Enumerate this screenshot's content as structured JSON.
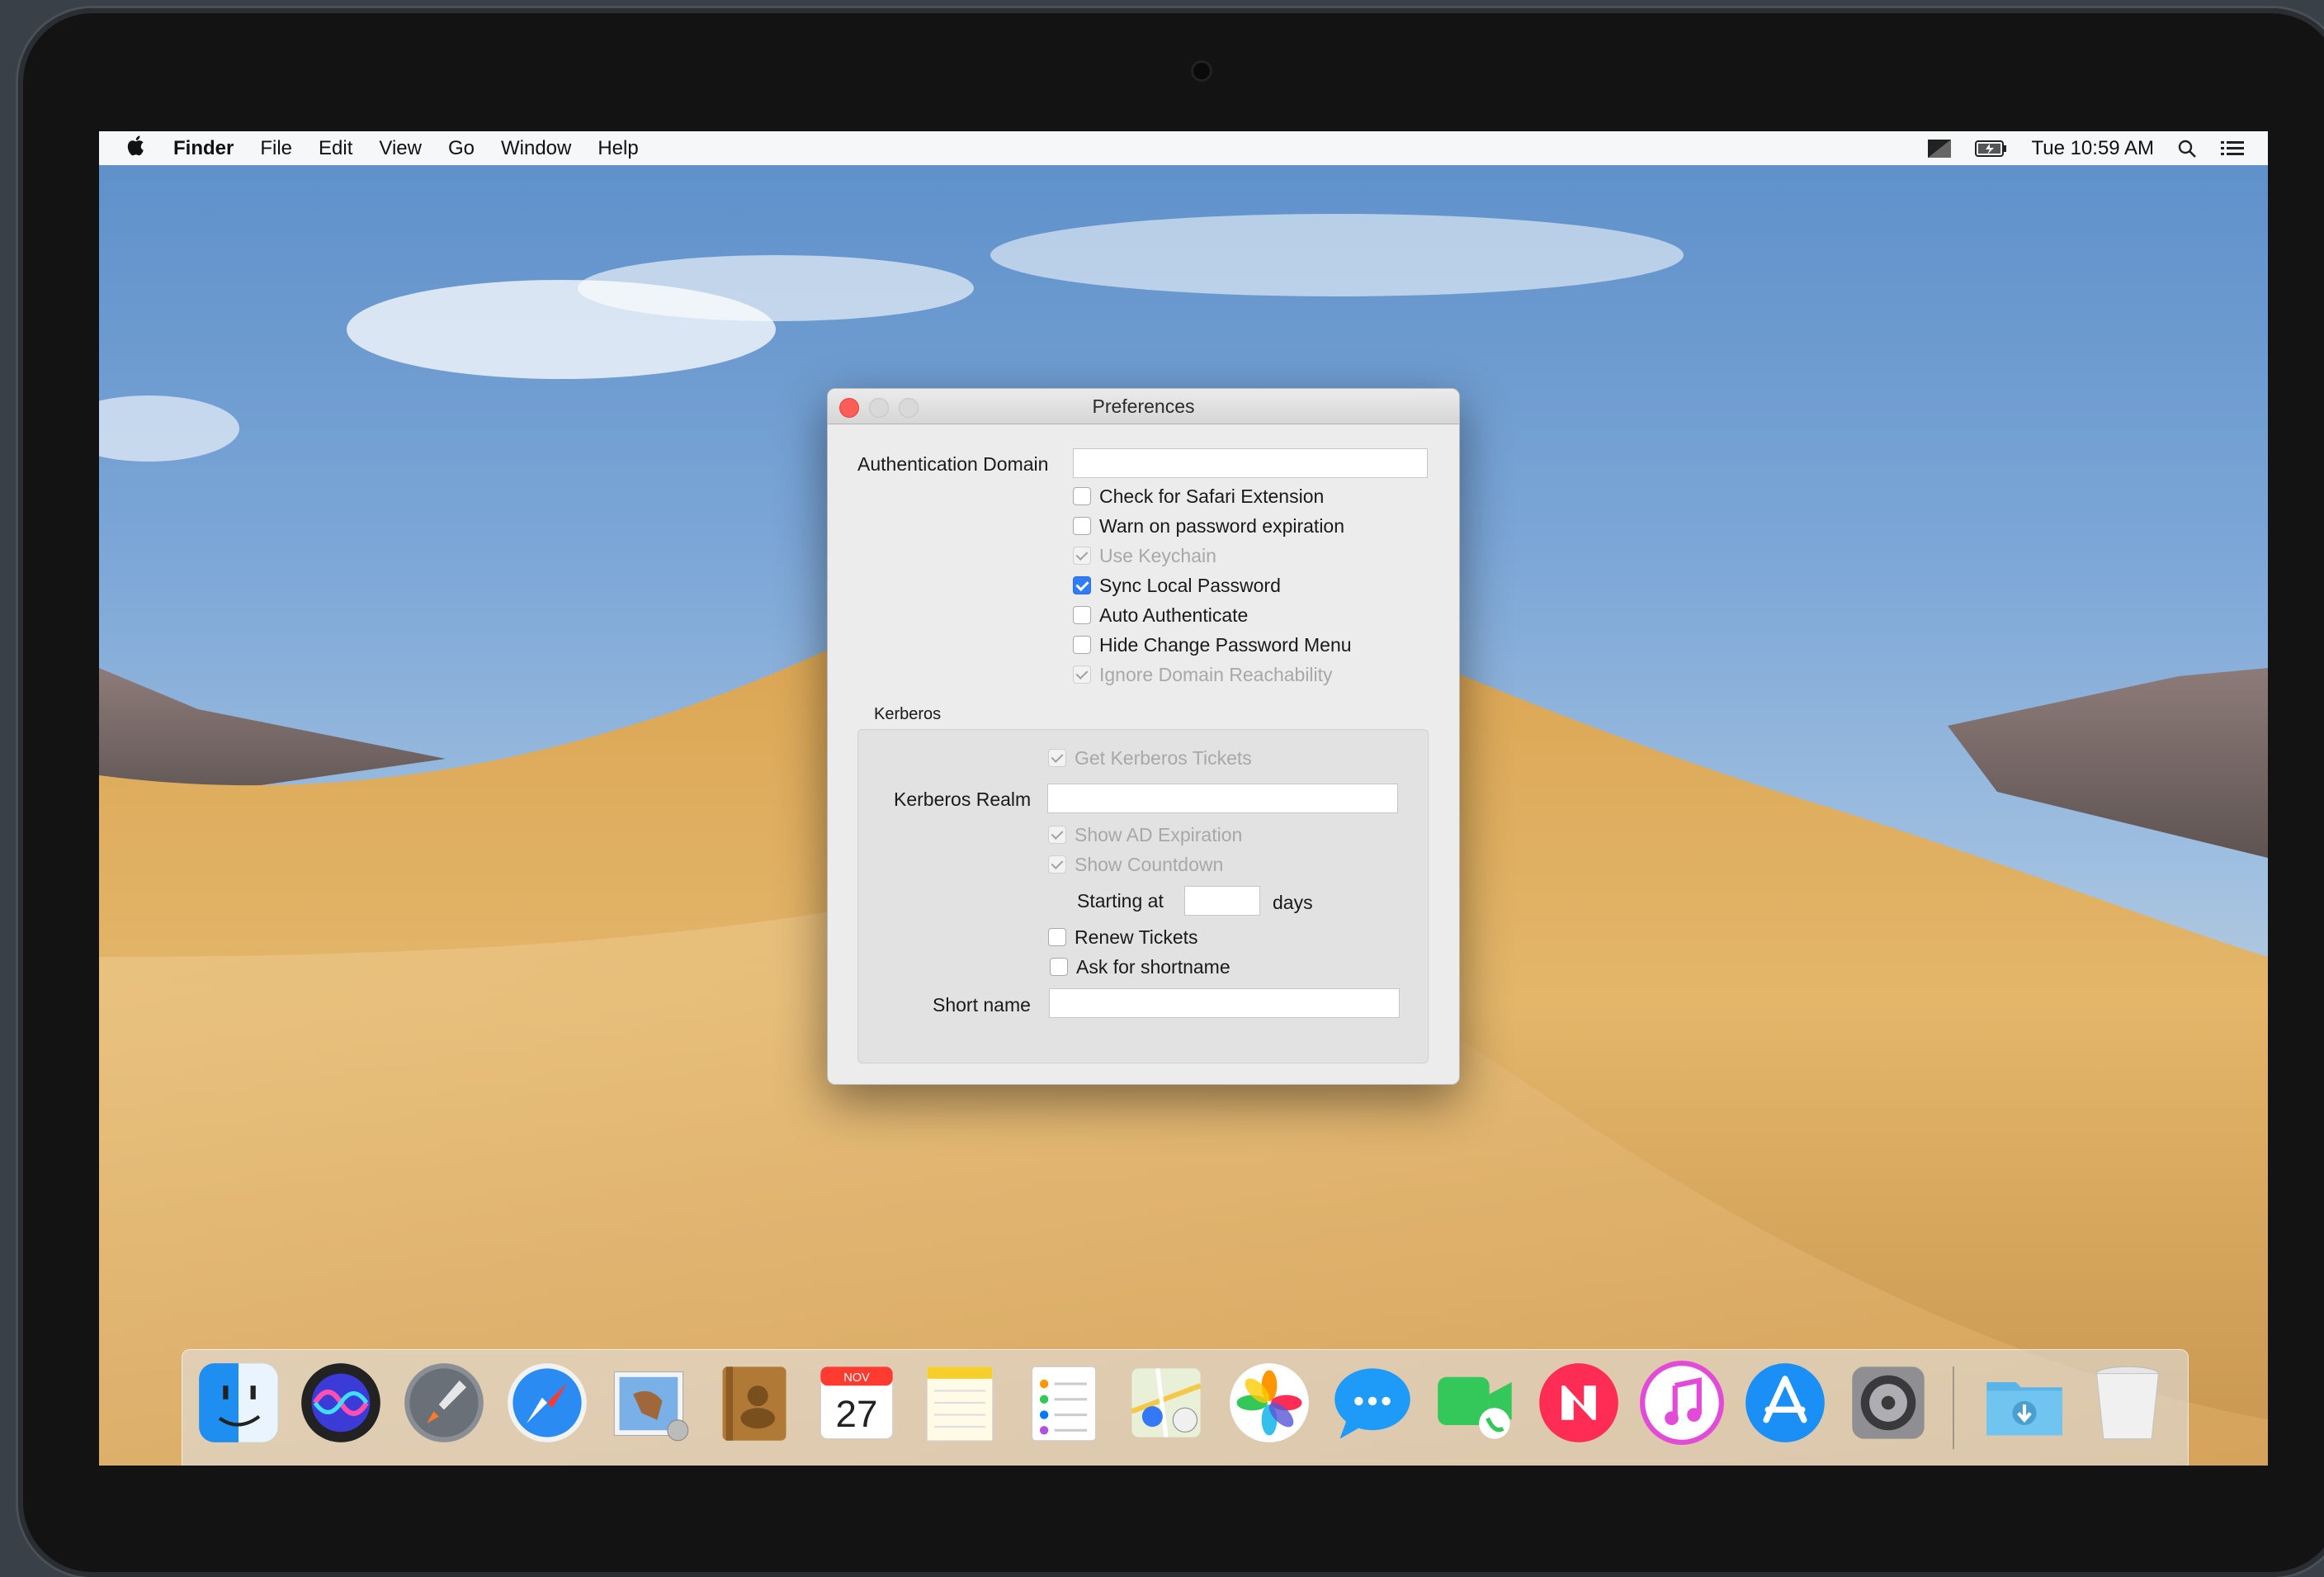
{
  "menubar": {
    "apple_icon": "apple-icon",
    "app_name": "Finder",
    "menus": [
      "File",
      "Edit",
      "View",
      "Go",
      "Window",
      "Help"
    ],
    "clock": "Tue 10:59 AM",
    "status_icons": [
      "display-icon",
      "battery-icon",
      "search-icon",
      "list-icon"
    ]
  },
  "window": {
    "title": "Preferences",
    "auth_domain_label": "Authentication Domain",
    "auth_domain_value": "",
    "checkboxes": [
      {
        "label": "Check for Safari Extension",
        "checked": false,
        "enabled": true
      },
      {
        "label": "Warn on password expiration",
        "checked": false,
        "enabled": true
      },
      {
        "label": "Use Keychain",
        "checked": true,
        "enabled": false
      },
      {
        "label": "Sync Local Password",
        "checked": true,
        "enabled": true
      },
      {
        "label": "Auto Authenticate",
        "checked": false,
        "enabled": true
      },
      {
        "label": "Hide Change Password Menu",
        "checked": false,
        "enabled": true
      },
      {
        "label": "Ignore Domain Reachability",
        "checked": true,
        "enabled": false
      }
    ],
    "kerberos": {
      "group_title": "Kerberos",
      "get_tickets": {
        "label": "Get Kerberos Tickets",
        "checked": true,
        "enabled": false
      },
      "realm_label": "Kerberos Realm",
      "realm_value": "",
      "show_ad_expiration": {
        "label": "Show AD Expiration",
        "checked": true,
        "enabled": false
      },
      "show_countdown": {
        "label": "Show Countdown",
        "checked": true,
        "enabled": false
      },
      "starting_at_label": "Starting at",
      "starting_at_value": "",
      "days_label": "days",
      "renew_tickets": {
        "label": "Renew Tickets",
        "checked": false,
        "enabled": true
      },
      "ask_shortname": {
        "label": "Ask for shortname",
        "checked": false,
        "enabled": true
      },
      "short_name_label": "Short name",
      "short_name_value": ""
    }
  },
  "dock": {
    "apps": [
      "finder-icon",
      "siri-icon",
      "launchpad-icon",
      "safari-icon",
      "mail-icon",
      "contacts-icon",
      "calendar-icon",
      "notes-icon",
      "reminders-icon",
      "maps-icon",
      "photos-icon",
      "messages-icon",
      "facetime-icon",
      "news-icon",
      "itunes-icon",
      "app-store-icon",
      "system-preferences-icon",
      "downloads-folder-icon",
      "trash-icon"
    ],
    "calendar_month": "NOV",
    "calendar_day": "27"
  }
}
